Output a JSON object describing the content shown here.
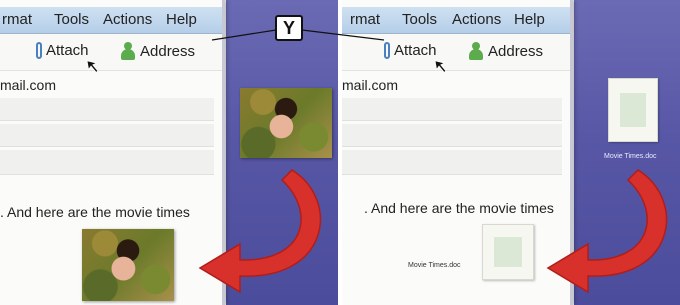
{
  "callout_label": "Y",
  "menu": [
    "rmat",
    "Tools",
    "Actions",
    "Help"
  ],
  "toolbar": {
    "attach_label": "Attach",
    "address_label": "Address"
  },
  "to_field_text": "mail.com",
  "body_text": ". And here are the movie times",
  "attachment_name": "Movie Times.doc",
  "desktop_icon_label": "Movie Times.doc",
  "colors": {
    "arrow": "#d8302a",
    "desktop": "#5757a6",
    "menubar": "#c3d7ec"
  }
}
